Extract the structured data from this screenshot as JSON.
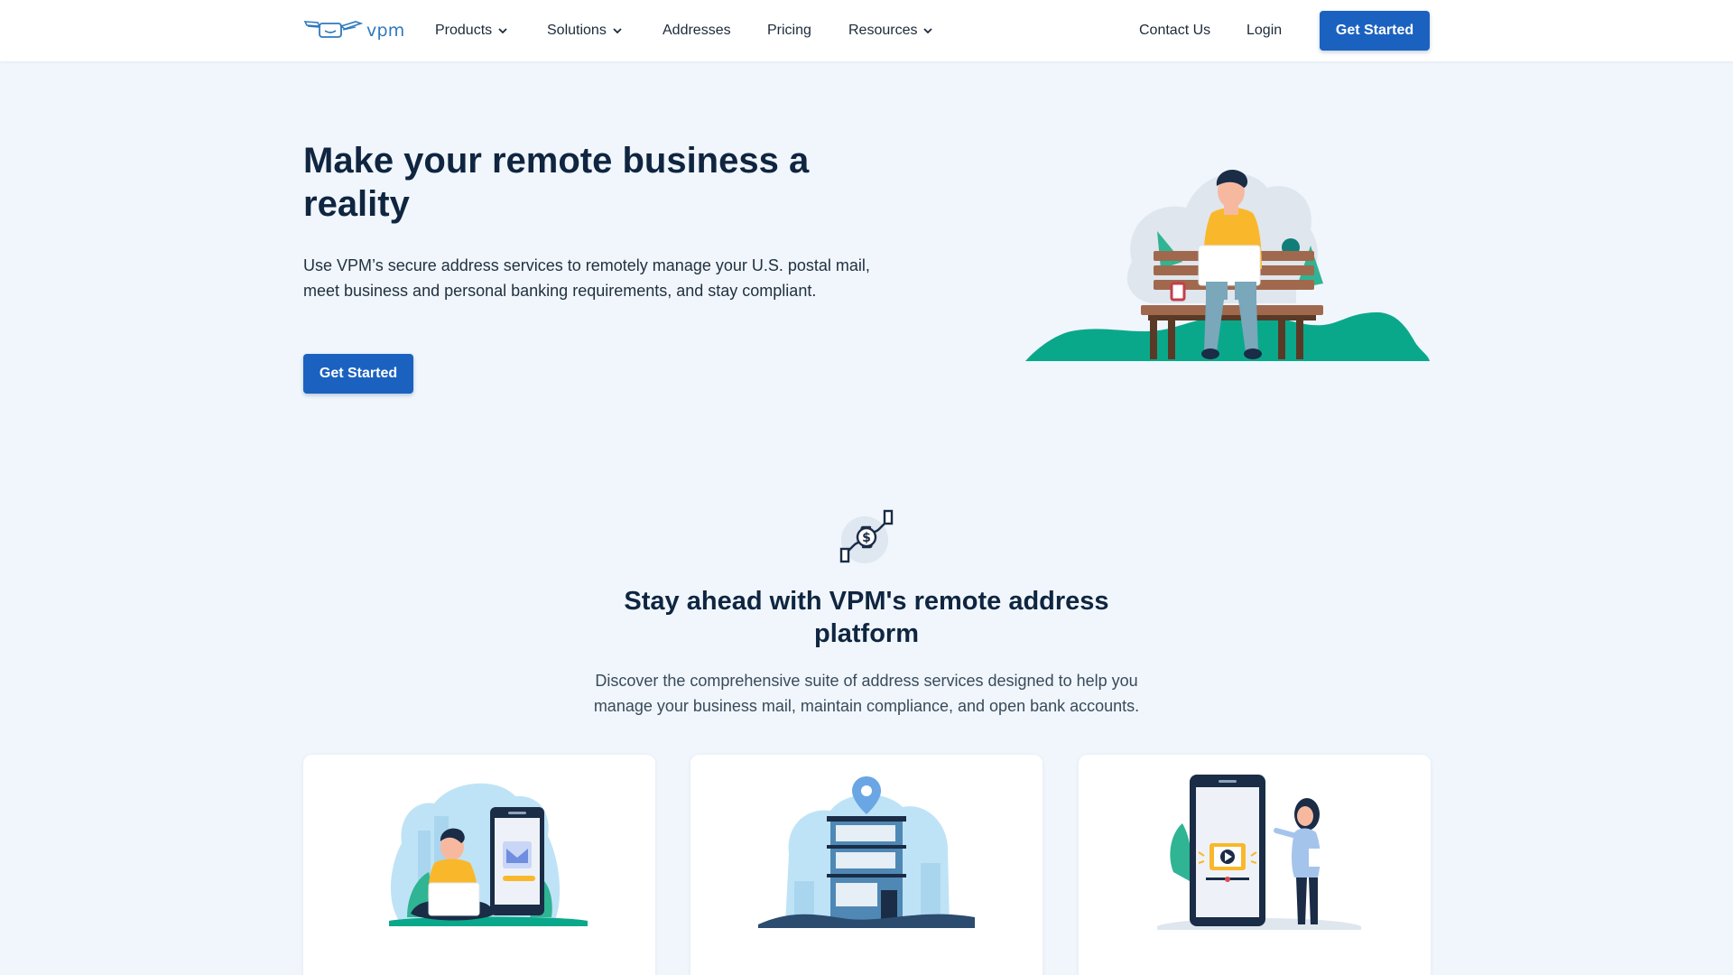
{
  "brand": {
    "name": "vpm"
  },
  "nav": {
    "items": [
      {
        "label": "Products",
        "dropdown": true
      },
      {
        "label": "Solutions",
        "dropdown": true
      },
      {
        "label": "Addresses",
        "dropdown": false
      },
      {
        "label": "Pricing",
        "dropdown": false
      },
      {
        "label": "Resources",
        "dropdown": true
      }
    ],
    "contact_label": "Contact Us",
    "login_label": "Login",
    "cta_label": "Get Started"
  },
  "hero": {
    "title": "Make your remote business a reality",
    "description": "Use VPM’s secure address services to remotely manage your U.S. postal mail, meet business and personal banking requirements, and stay compliant.",
    "cta_label": "Get Started"
  },
  "platform": {
    "icon": "money-exchange-icon",
    "title": "Stay ahead with VPM's remote address platform",
    "description": "Discover the comprehensive suite of address services designed to help you manage your business mail, maintain compliance, and open bank accounts."
  },
  "cards": [
    {
      "illustration": "person-with-laptop-and-phone-mail-illustration"
    },
    {
      "illustration": "office-building-location-pin-illustration"
    },
    {
      "illustration": "woman-with-phone-video-illustration"
    }
  ],
  "colors": {
    "primary": "#1b62c0",
    "heading": "#0f2540",
    "background": "#f0f6fc",
    "accent_green": "#0aa88b",
    "logo_blue": "#2f79bd"
  }
}
